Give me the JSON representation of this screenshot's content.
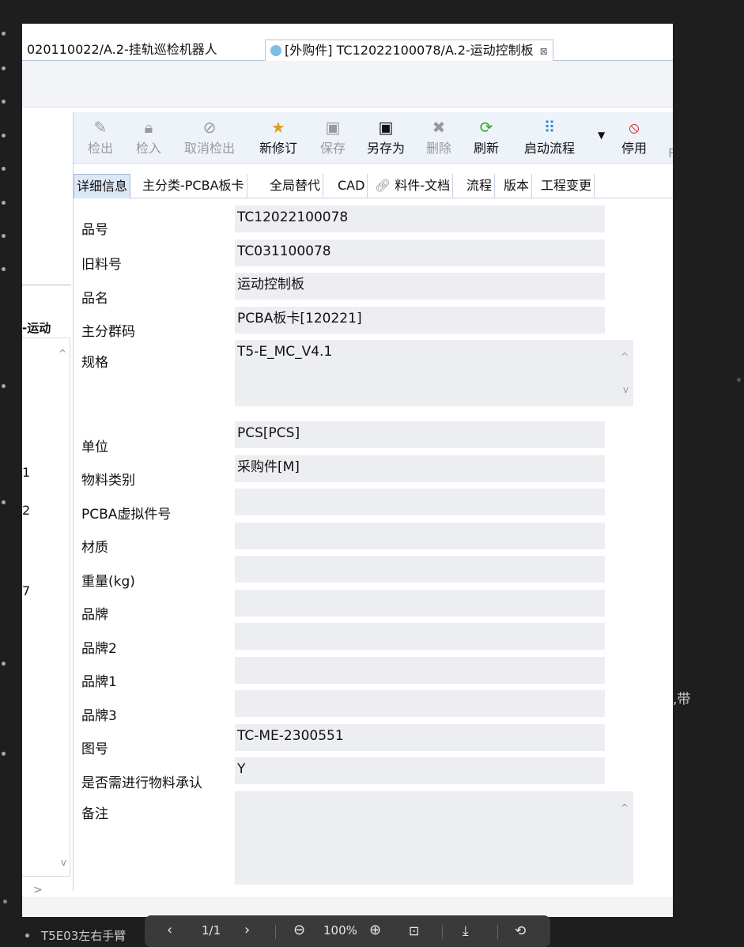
{
  "background": {
    "fragment_dai": ",带",
    "under_text": "T5E03左右手臂"
  },
  "window": {
    "tabs": [
      {
        "label": "020110022/A.2-挂轨巡检机器人"
      },
      {
        "label": "[外购件] TC12022100078/A.2-运动控制板",
        "close": "⊠"
      }
    ]
  },
  "left_pane": {
    "title": "-运动",
    "numbers": [
      "1",
      "2",
      "7"
    ]
  },
  "toolbar": {
    "items": [
      {
        "label": "检出",
        "icon": "doc-pen-icon"
      },
      {
        "label": "检入",
        "icon": "doc-lock-icon"
      },
      {
        "label": "取消检出",
        "icon": "cancel-checkout-icon"
      },
      {
        "label": "新修订",
        "icon": "new-revision-icon"
      },
      {
        "label": "保存",
        "icon": "save-icon"
      },
      {
        "label": "另存为",
        "icon": "save-as-icon"
      },
      {
        "label": "删除",
        "icon": "delete-icon"
      },
      {
        "label": "刷新",
        "icon": "refresh-icon"
      },
      {
        "label": "启动流程",
        "icon": "workflow-icon"
      },
      {
        "label": "停用",
        "icon": "disable-icon"
      }
    ],
    "edge_text": "F"
  },
  "form_tabs": [
    {
      "label": "详细信息"
    },
    {
      "label": "主分类-PCBA板卡"
    },
    {
      "label": "全局替代"
    },
    {
      "label": "CAD"
    },
    {
      "label": "料件-文档"
    },
    {
      "label": "流程"
    },
    {
      "label": "版本"
    },
    {
      "label": "工程变更"
    }
  ],
  "fields": [
    {
      "label": "品号",
      "value": "TC12022100078"
    },
    {
      "label": "旧料号",
      "value": "TC031100078"
    },
    {
      "label": "品名",
      "value": "运动控制板"
    },
    {
      "label": "主分群码",
      "value": "PCBA板卡[120221]"
    },
    {
      "label": "规格",
      "value": "T5-E_MC_V4.1"
    },
    {
      "label": "单位",
      "value": "PCS[PCS]"
    },
    {
      "label": "物料类别",
      "value": "采购件[M]"
    },
    {
      "label": "PCBA虚拟件号",
      "value": ""
    },
    {
      "label": "材质",
      "value": ""
    },
    {
      "label": "重量(kg)",
      "value": ""
    },
    {
      "label": "品牌",
      "value": ""
    },
    {
      "label": "品牌2",
      "value": ""
    },
    {
      "label": "品牌1",
      "value": ""
    },
    {
      "label": "品牌3",
      "value": ""
    },
    {
      "label": "图号",
      "value": "TC-ME-2300551"
    },
    {
      "label": "是否需进行物料承认",
      "value": "Y"
    },
    {
      "label": "备注",
      "value": ""
    }
  ],
  "pdf_toolbar": {
    "page_indicator": "1/1",
    "zoom": "100%"
  }
}
